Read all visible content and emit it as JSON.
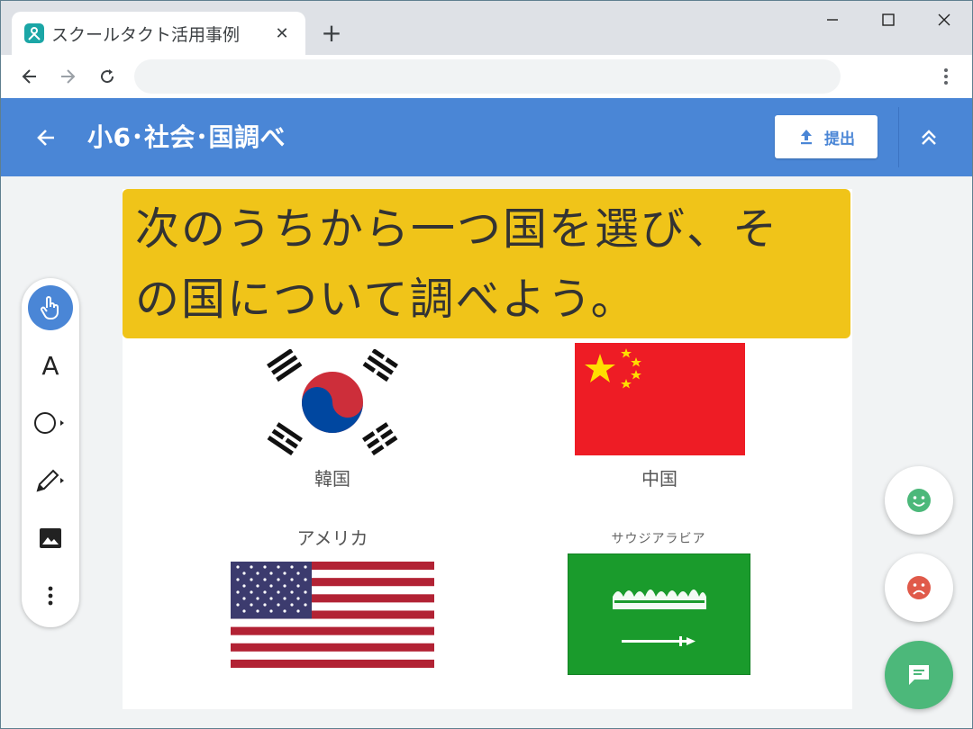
{
  "browser": {
    "tab_title": "スクールタクト活用事例",
    "tab_close": "✕",
    "new_tab": "+",
    "favicon_color": "#1ba6a6"
  },
  "app": {
    "title": "小6･社会･国調べ",
    "submit_label": "提出",
    "header_color": "#4a86d6"
  },
  "slide": {
    "prompt_line1": "次のうちから一つ国を選び、そ",
    "prompt_line2": "の国について調べよう。",
    "prompt_bg": "#f0c419",
    "countries": [
      {
        "name": "韓国",
        "flag": "south-korea-flag"
      },
      {
        "name": "中国",
        "flag": "china-flag"
      },
      {
        "name": "アメリカ",
        "flag": "usa-flag"
      },
      {
        "name": "サウジアラビア",
        "flag": "saudi-arabia-flag"
      }
    ],
    "saudi_calligraphy": "لا إله إلا الله"
  },
  "tools": {
    "text_tool_label": "A",
    "items": [
      "pointer-tool",
      "text-tool",
      "shape-tool",
      "pen-tool",
      "image-tool",
      "more-tool"
    ]
  },
  "fabs": {
    "smile_color": "#4cb87a",
    "frown_color": "#e05a4a",
    "chat_color": "#4cb87a"
  }
}
